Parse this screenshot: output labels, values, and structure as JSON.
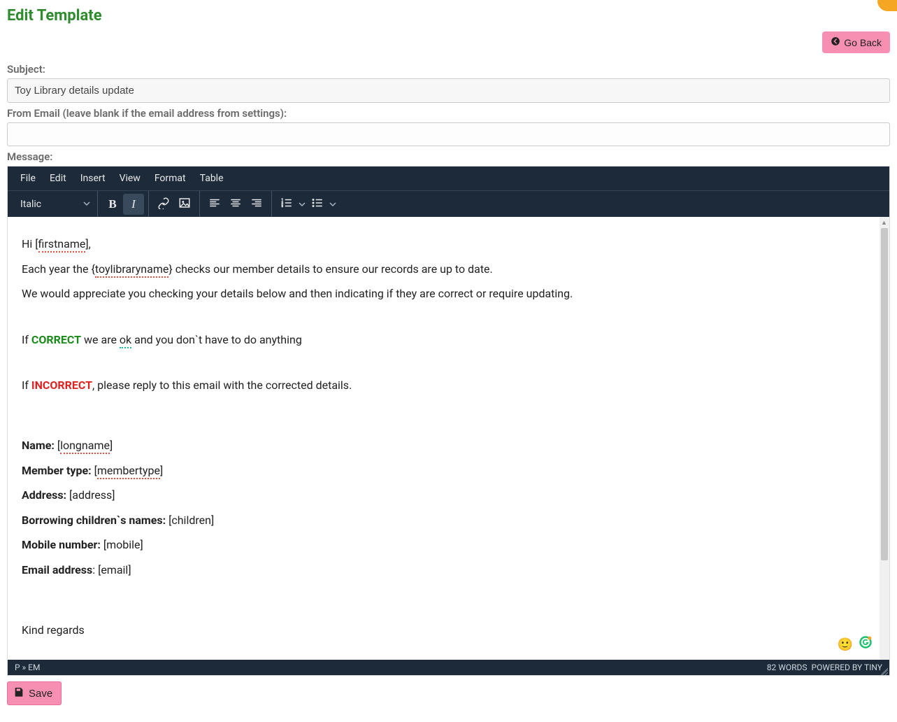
{
  "page": {
    "title": "Edit Template"
  },
  "goBack": {
    "label": "Go Back"
  },
  "fields": {
    "subject_label": "Subject:",
    "subject_value": "Toy Library details update",
    "from_label": "From Email (leave blank if the email address from settings):",
    "from_value": "",
    "message_label": "Message:"
  },
  "editor": {
    "menubar": [
      "File",
      "Edit",
      "Insert",
      "View",
      "Format",
      "Table"
    ],
    "style_select": "Italic",
    "icons": {
      "bold": "bold-icon",
      "italic": "italic-icon",
      "link": "link-icon",
      "image": "image-icon",
      "align_left": "align-left-icon",
      "align_center": "align-center-icon",
      "align_right": "align-right-icon",
      "numbered_list": "numbered-list-icon",
      "bullet_list": "bullet-list-icon"
    },
    "body": {
      "greet_prefix": "Hi [",
      "greet_token": "firstname",
      "greet_suffix": "],",
      "line2_a": "Each year the {",
      "line2_token": "toylibraryname",
      "line2_b": "} checks our member details to ensure our records are up to date.",
      "line3": "We would appreciate you checking your details below and then indicating if they are correct or require updating.",
      "correct_pre": "If ",
      "correct_word": "CORRECT",
      "correct_mid": " we are ",
      "correct_ok": "ok",
      "correct_post": " and you don`t have to do anything",
      "incorrect_pre": "If ",
      "incorrect_word": "INCORRECT",
      "incorrect_post": ", please reply to this email with the corrected details.",
      "f_name_label": "Name:",
      "f_name_val_a": " [",
      "f_name_token": "longname",
      "f_name_val_b": "]",
      "f_member_label": "Member type:",
      "f_member_val_a": " [",
      "f_member_token": "membertype",
      "f_member_val_b": "]",
      "f_address_label": "Address:",
      "f_address_val": " [address]",
      "f_children_label": "Borrowing children`s names:",
      "f_children_val": " [children]",
      "f_mobile_label": "Mobile number:",
      "f_mobile_val": " [mobile]",
      "f_email_label": "Email address",
      "f_email_colon": ":",
      "f_email_val": " [email]",
      "signoff": "Kind regards"
    },
    "status": {
      "path": "P » EM",
      "words": "82 WORDS",
      "powered": "POWERED BY TINY"
    }
  },
  "save": {
    "label": "Save"
  }
}
